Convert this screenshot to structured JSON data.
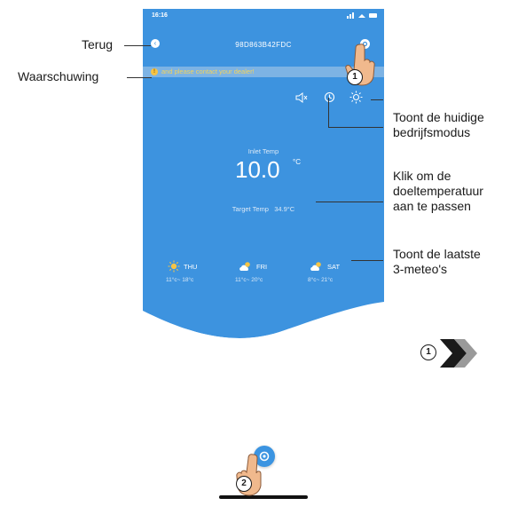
{
  "status_bar": {
    "time": "16:16"
  },
  "header": {
    "device_id": "98D863B42FDC",
    "back_glyph": "‹",
    "icons": [
      "back-icon",
      "settings-icon"
    ]
  },
  "warning": {
    "icon_glyph": "!",
    "text": "and please contact your dealer!"
  },
  "mode_icons": [
    "mute-icon",
    "timer-icon",
    "sun-icon"
  ],
  "temperature": {
    "inlet_label": "Inlet Temp",
    "inlet_value": "10.0",
    "unit": "°C",
    "target_label": "Target Temp",
    "target_value": "34.9°C"
  },
  "weather": [
    {
      "day": "THU",
      "range": "11°c~ 18°c",
      "icon": "sun-icon"
    },
    {
      "day": "FRI",
      "range": "11°c~ 20°c",
      "icon": "cloud-sun-icon"
    },
    {
      "day": "SAT",
      "range": "8°c~ 21°c",
      "icon": "cloud-sun-icon"
    }
  ],
  "annotations": {
    "back": "Terug",
    "warning": "Waarschuwing",
    "mode": [
      "Toont de huidige",
      "bedrijfsmodus"
    ],
    "target": [
      "Klik om de",
      "doeltemperatuur",
      "aan te passen"
    ],
    "weather": [
      "Toont de laatste",
      "3-meteo's"
    ],
    "marker_1": "1",
    "marker_2": "2"
  },
  "colors": {
    "header_blue": "#3d93df",
    "warning_text": "#f3d35c",
    "next_arrow_dark": "#1a1a1a",
    "next_arrow_gray": "#9a9a9a"
  }
}
